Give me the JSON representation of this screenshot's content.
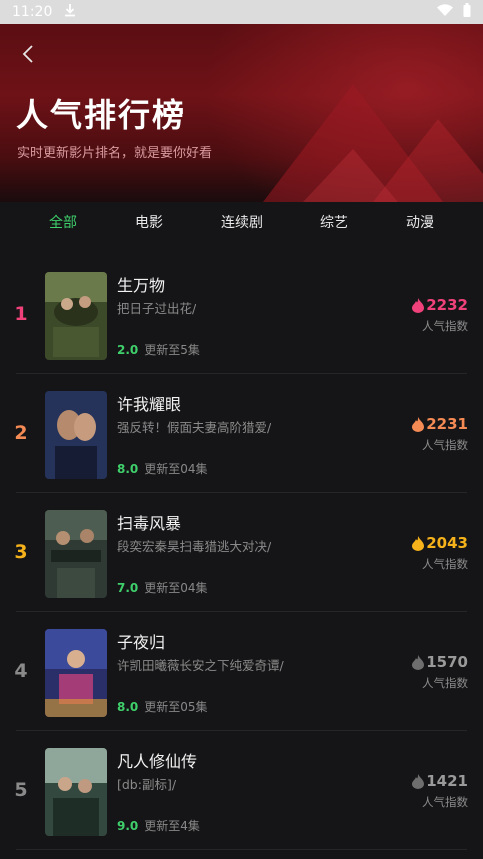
{
  "status_bar": {
    "time": "11:20"
  },
  "header": {
    "title": "人气排行榜",
    "subtitle": "实时更新影片排名，就是要你好看"
  },
  "tabs": [
    {
      "label": "全部",
      "active": true
    },
    {
      "label": "电影",
      "active": false
    },
    {
      "label": "连续剧",
      "active": false
    },
    {
      "label": "综艺",
      "active": false
    },
    {
      "label": "动漫",
      "active": false
    }
  ],
  "colors": {
    "accent_green": "#3fcf6b",
    "rank1": "#f0417a",
    "rank2": "#f48a54",
    "rank3": "#f5b21b",
    "rank_other": "#8a8a8a"
  },
  "items": [
    {
      "rank": "1",
      "title": "生万物",
      "desc": "把日子过出花/",
      "score": "2.0",
      "update": "更新至5集",
      "heat": "2232",
      "heat_label": "人气指数"
    },
    {
      "rank": "2",
      "title": "许我耀眼",
      "desc": "强反转！假面夫妻高阶猎爱/",
      "score": "8.0",
      "update": "更新至04集",
      "heat": "2231",
      "heat_label": "人气指数"
    },
    {
      "rank": "3",
      "title": "扫毒风暴",
      "desc": "段奕宏秦昊扫毒猎逃大对决/",
      "score": "7.0",
      "update": "更新至04集",
      "heat": "2043",
      "heat_label": "人气指数"
    },
    {
      "rank": "4",
      "title": "子夜归",
      "desc": "许凯田曦薇长安之下纯爱奇谭/",
      "score": "8.0",
      "update": "更新至05集",
      "heat": "1570",
      "heat_label": "人气指数"
    },
    {
      "rank": "5",
      "title": "凡人修仙传",
      "desc": "[db:副标]/",
      "score": "9.0",
      "update": "更新至4集",
      "heat": "1421",
      "heat_label": "人气指数"
    }
  ]
}
